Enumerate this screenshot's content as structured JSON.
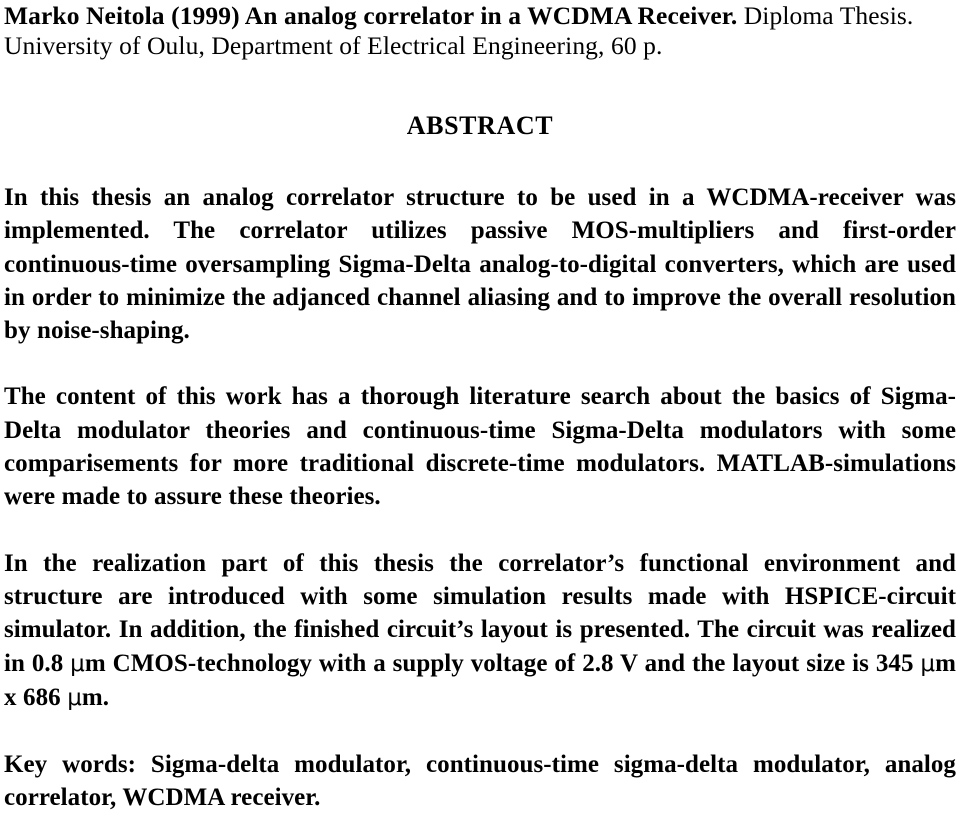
{
  "document": {
    "citation": {
      "bold_part": "Marko Neitola (1999) An analog correlator in a WCDMA Receiver.",
      "regular_part": " Diploma Thesis. University of Oulu, Department of Electrical Engineering, 60 p."
    },
    "heading": "ABSTRACT",
    "paragraphs": [
      {
        "id": "p1",
        "text": "In this thesis an analog correlator structure to be used in a WCDMA-receiver was implemented. The correlator utilizes passive MOS-multipliers and first-order continuous-time oversampling Sigma-Delta analog-to-digital converters, which are used in order to minimize the adjanced channel aliasing and to improve the overall resolution by noise-shaping."
      },
      {
        "id": "p2",
        "text": "The content of this work has a thorough literature search about the basics of Sigma-Delta modulator theories and continuous-time Sigma-Delta modulators with some comparisements for more traditional discrete-time modulators. MATLAB-simulations were made to assure these theories."
      }
    ],
    "paragraph3": {
      "seg1": "In the realization part of this thesis the correlator’s functional environment and structure are introduced with some simulation results made with HSPICE-circuit simulator. In addition, the finished circuit’s layout is presented. The circuit was realized in 0.8 ",
      "mu1": "μ",
      "seg2": "m CMOS-technology with a supply voltage of 2.8 V and the layout size is 345 ",
      "mu2": "μ",
      "seg3": "m x 686 ",
      "mu3": "μ",
      "seg4": "m."
    },
    "keywords": {
      "label": "Key words: ",
      "terms": "Sigma-delta modulator, continuous-time sigma-delta modulator, analog correlator, WCDMA receiver."
    },
    "colors": {
      "text": "#000000",
      "background": "#ffffff"
    }
  }
}
